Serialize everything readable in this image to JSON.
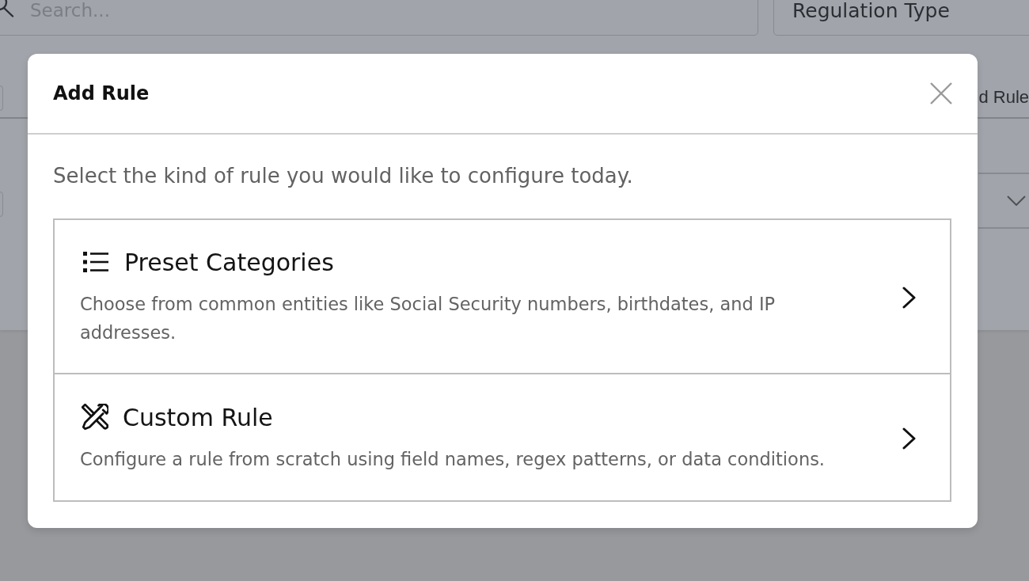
{
  "background": {
    "search": {
      "placeholder": "Search..."
    },
    "regulation_filter": {
      "label": "Regulation Type"
    },
    "add_rule_button": {
      "label": "d Rule"
    }
  },
  "modal": {
    "title": "Add Rule",
    "description": "Select the kind of rule you would like to configure today.",
    "options": [
      {
        "title": "Preset Categories",
        "description": "Choose from common entities like Social Security numbers, birthdates, and IP addresses."
      },
      {
        "title": "Custom Rule",
        "description": "Configure a rule from scratch using field names, regex patterns, or data conditions."
      }
    ]
  }
}
